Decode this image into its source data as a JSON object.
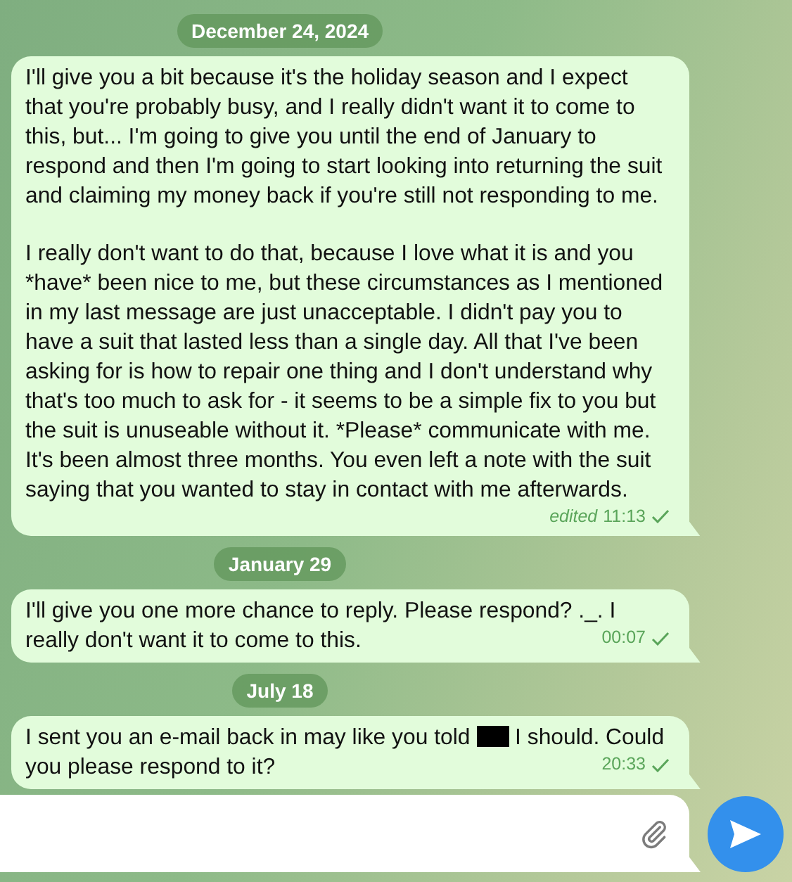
{
  "chat": [
    {
      "kind": "date",
      "label": "December 24, 2024"
    },
    {
      "kind": "message",
      "paragraphs": [
        [
          {
            "kind": "text",
            "text": "I'll give you a bit because it's the holiday season and I expect that you're probably busy, and I really didn't want it to come to this, but... I'm going to give you until the end of January to respond and then I'm going to start looking into returning the suit and claiming my money back if you're still not responding to me."
          }
        ],
        [
          {
            "kind": "text",
            "text": "I really don't want to do that, because I love what it is and you *have* been nice to me, but these circumstances as I mentioned in my last message are just unacceptable. I didn't pay you to have a suit that lasted less than a single day. All that I've been asking for is how to repair one thing and I don't understand why that's too much to ask for - it seems to be a simple fix to you but the suit is unuseable without it. *Please* communicate with me. It's been almost three months. You even left a note with the suit saying that you wanted to stay in contact with me afterwards."
          }
        ]
      ],
      "edited": "edited",
      "time": "11:13",
      "sent": true
    },
    {
      "kind": "date",
      "label": "January 29"
    },
    {
      "kind": "message",
      "paragraphs": [
        [
          {
            "kind": "text",
            "text": "I'll give you one more chance to reply. Please respond? ._. I really don't want it to come to this."
          }
        ]
      ],
      "time": "00:07",
      "sent": true
    },
    {
      "kind": "date",
      "label": "July 18"
    },
    {
      "kind": "message",
      "paragraphs": [
        [
          {
            "kind": "text",
            "text": "I sent you an e-mail back in may like you told"
          },
          {
            "kind": "redacted"
          },
          {
            "kind": "text",
            "text": "I should. Could you please respond to it?"
          }
        ]
      ],
      "time": "20:33",
      "sent": true
    }
  ]
}
